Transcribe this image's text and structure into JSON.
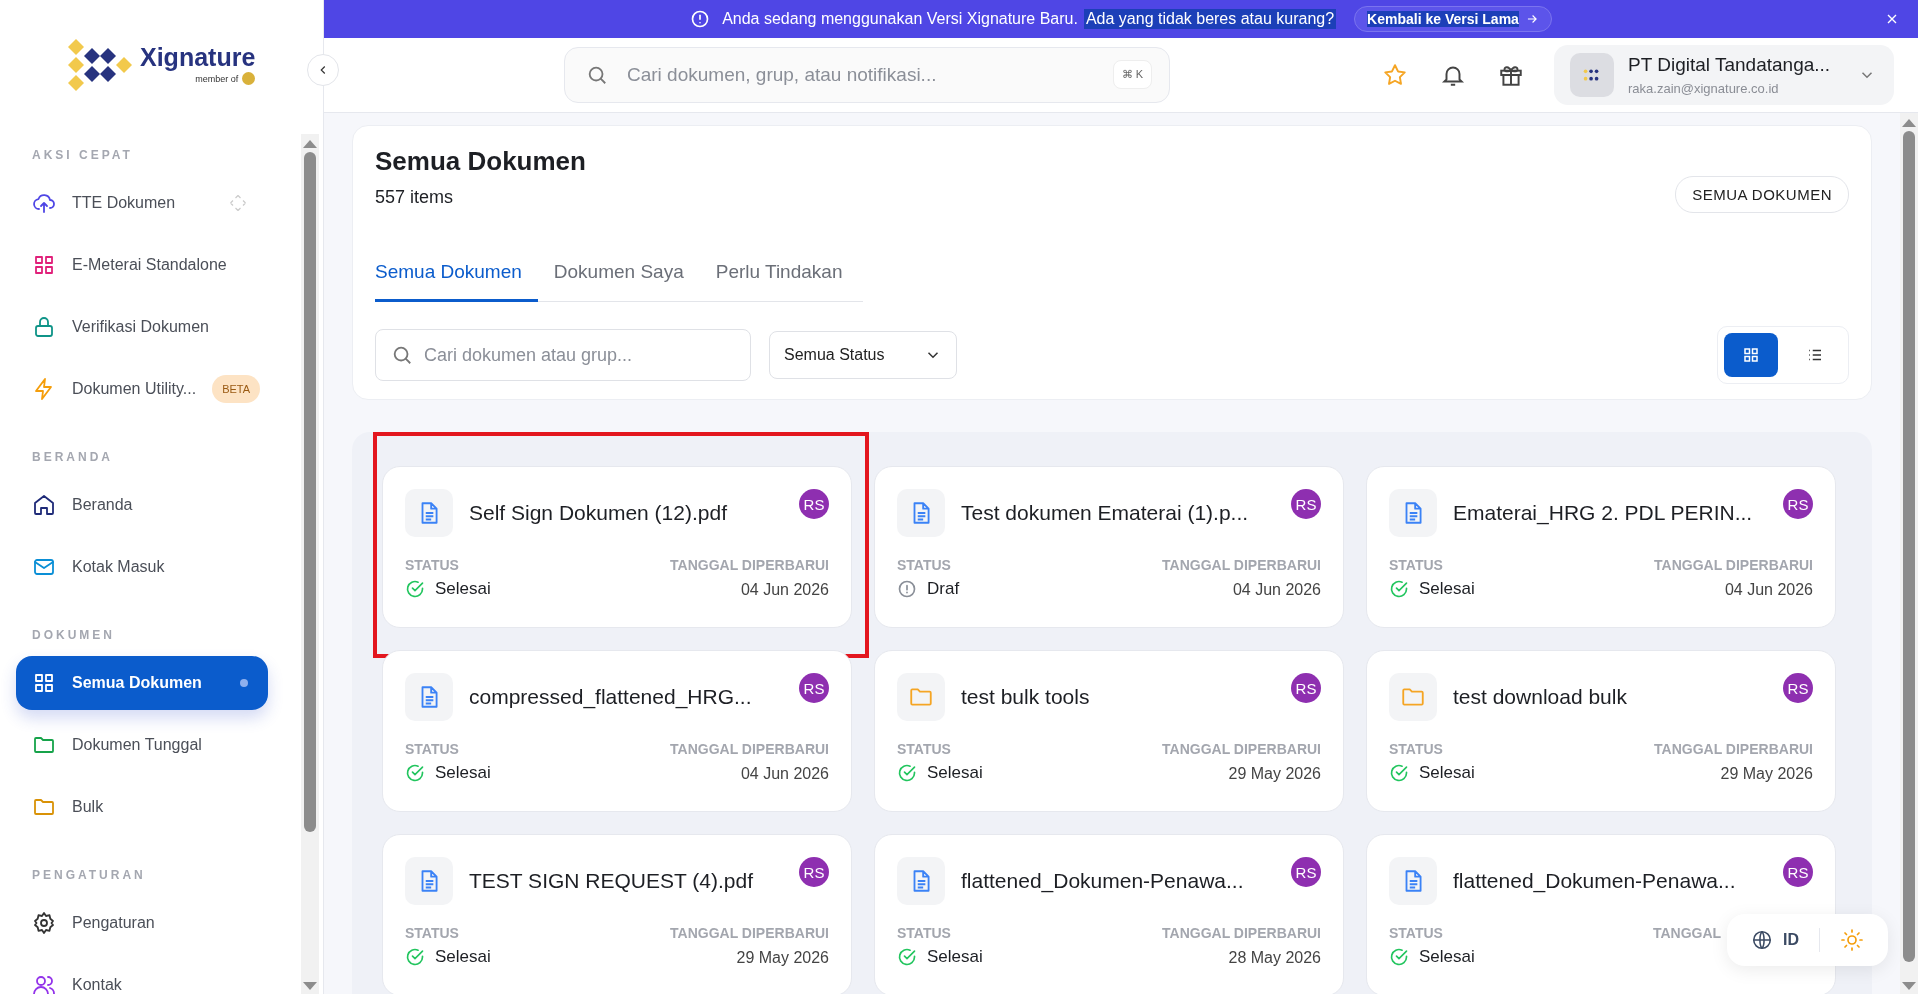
{
  "banner": {
    "message": "Anda sedang menggunakan Versi Xignature Baru.",
    "question": "Ada yang tidak beres atau kurang?",
    "button": "Kembali ke Versi Lama"
  },
  "logo": {
    "name": "Xignature",
    "tagline": "member of"
  },
  "sidebar": {
    "sections": [
      {
        "title": "AKSI CEPAT",
        "items": [
          {
            "label": "TTE Dokumen",
            "selected": false
          },
          {
            "label": "E-Meterai Standalone",
            "selected": false
          },
          {
            "label": "Verifikasi Dokumen",
            "selected": false
          },
          {
            "label": "Dokumen Utility...",
            "selected": false,
            "badge": "BETA"
          }
        ]
      },
      {
        "title": "BERANDA",
        "items": [
          {
            "label": "Beranda",
            "selected": false
          },
          {
            "label": "Kotak Masuk",
            "selected": false
          }
        ]
      },
      {
        "title": "DOKUMEN",
        "items": [
          {
            "label": "Semua Dokumen",
            "selected": true
          },
          {
            "label": "Dokumen Tunggal",
            "selected": false
          },
          {
            "label": "Bulk",
            "selected": false
          }
        ]
      },
      {
        "title": "PENGATURAN",
        "items": [
          {
            "label": "Pengaturan",
            "selected": false
          },
          {
            "label": "Kontak",
            "selected": false
          }
        ]
      }
    ]
  },
  "header": {
    "search_placeholder": "Cari dokumen, grup, atau notifikasi...",
    "shortcut": "⌘ K",
    "account": {
      "name": "PT Digital Tandatanga...",
      "email": "raka.zain@xignature.co.id"
    }
  },
  "page": {
    "title": "Semua Dokumen",
    "count": "557 items",
    "scope_button": "SEMUA DOKUMEN",
    "tabs": [
      {
        "label": "Semua Dokumen",
        "selected": true
      },
      {
        "label": "Dokumen Saya",
        "selected": false
      },
      {
        "label": "Perlu Tindakan",
        "selected": false
      }
    ],
    "search_placeholder": "Cari dokumen atau grup...",
    "status_filter": "Semua Status",
    "views": [
      {
        "kind": "grid",
        "selected": true
      },
      {
        "kind": "list",
        "selected": false
      }
    ]
  },
  "cards": [
    {
      "name": "Self Sign Dokumen (12).pdf",
      "kind": "file",
      "owner": "RS",
      "status_label": "STATUS",
      "status": {
        "text": "Selesai",
        "kind": "done"
      },
      "date_label": "TANGGAL DIPERBARUI",
      "date": "04 Jun 2026",
      "highlighted": true
    },
    {
      "name": "Test dokumen Ematerai (1).p...",
      "kind": "file",
      "owner": "RS",
      "status_label": "STATUS",
      "status": {
        "text": "Draf",
        "kind": "draft"
      },
      "date_label": "TANGGAL DIPERBARUI",
      "date": "04 Jun 2026",
      "highlighted": false
    },
    {
      "name": "Ematerai_HRG 2. PDL PERIN...",
      "kind": "file",
      "owner": "RS",
      "status_label": "STATUS",
      "status": {
        "text": "Selesai",
        "kind": "done"
      },
      "date_label": "TANGGAL DIPERBARUI",
      "date": "04 Jun 2026",
      "highlighted": false
    },
    {
      "name": "compressed_flattened_HRG...",
      "kind": "file",
      "owner": "RS",
      "status_label": "STATUS",
      "status": {
        "text": "Selesai",
        "kind": "done"
      },
      "date_label": "TANGGAL DIPERBARUI",
      "date": "04 Jun 2026",
      "highlighted": false
    },
    {
      "name": "test bulk tools",
      "kind": "folder",
      "owner": "RS",
      "status_label": "STATUS",
      "status": {
        "text": "Selesai",
        "kind": "done"
      },
      "date_label": "TANGGAL DIPERBARUI",
      "date": "29 May 2026",
      "highlighted": false
    },
    {
      "name": "test download bulk",
      "kind": "folder",
      "owner": "RS",
      "status_label": "STATUS",
      "status": {
        "text": "Selesai",
        "kind": "done"
      },
      "date_label": "TANGGAL DIPERBARUI",
      "date": "29 May 2026",
      "highlighted": false
    },
    {
      "name": "TEST SIGN REQUEST (4).pdf",
      "kind": "file",
      "owner": "RS",
      "status_label": "STATUS",
      "status": {
        "text": "Selesai",
        "kind": "done"
      },
      "date_label": "TANGGAL DIPERBARUI",
      "date": "29 May 2026",
      "highlighted": false
    },
    {
      "name": "flattened_Dokumen-Penawa...",
      "kind": "file",
      "owner": "RS",
      "status_label": "STATUS",
      "status": {
        "text": "Selesai",
        "kind": "done"
      },
      "date_label": "TANGGAL DIPERBARUI",
      "date": "28 May 2026",
      "highlighted": false
    },
    {
      "name": "flattened_Dokumen-Penawa...",
      "kind": "file",
      "owner": "RS",
      "status_label": "STATUS",
      "status": {
        "text": "Selesai",
        "kind": "done"
      },
      "date_label": "TANGGAL",
      "highlighted": false
    }
  ],
  "prefs": {
    "language": "ID"
  }
}
